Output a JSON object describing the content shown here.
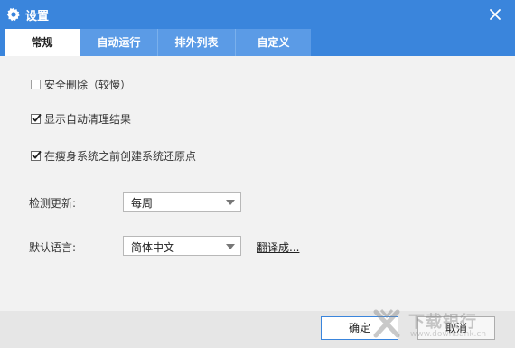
{
  "window": {
    "title": "设置"
  },
  "tabs": [
    {
      "label": "常规",
      "active": true
    },
    {
      "label": "自动运行",
      "active": false
    },
    {
      "label": "排外列表",
      "active": false
    },
    {
      "label": "自定义",
      "active": false
    }
  ],
  "options": [
    {
      "label": "安全删除（较慢）",
      "checked": false
    },
    {
      "label": "显示自动清理结果",
      "checked": true
    },
    {
      "label": "在瘦身系统之前创建系统还原点",
      "checked": true
    }
  ],
  "update": {
    "label": "检测更新:",
    "value": "每周"
  },
  "language": {
    "label": "默认语言:",
    "value": "简体中文",
    "translate_link": "翻译成..."
  },
  "buttons": {
    "ok": "确定",
    "cancel": "取消"
  },
  "watermark": {
    "text": "下载银行",
    "url": "www.downbank.cn"
  },
  "colors": {
    "accent": "#3a85dc",
    "tab_inactive": "#5b9be6"
  }
}
